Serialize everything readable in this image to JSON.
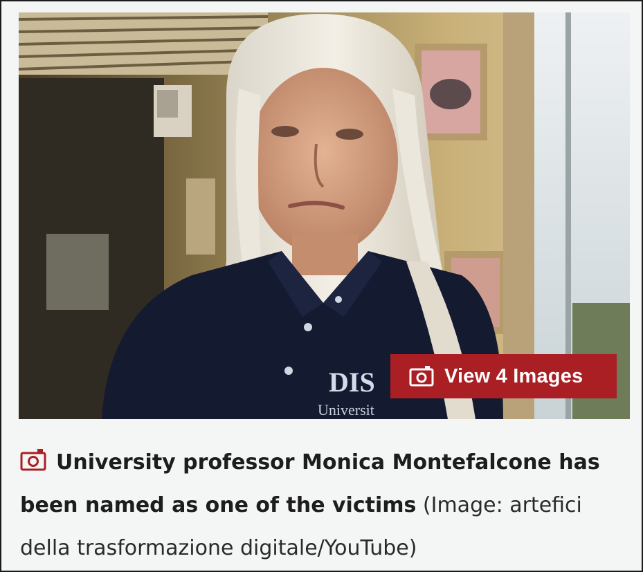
{
  "image": {
    "alt": "",
    "shirt_text_line1": "DIS",
    "shirt_text_line2": "Universit"
  },
  "gallery_button": {
    "label": "View 4 Images",
    "icon": "camera-icon",
    "background": "#a91f24"
  },
  "caption": {
    "icon": "camera-icon",
    "headline": "University professor Monica Montefalcone has been named as one of the victims",
    "credit": "(Image: artefici della trasformazione digitale/YouTube)",
    "accent": "#a91f24"
  }
}
